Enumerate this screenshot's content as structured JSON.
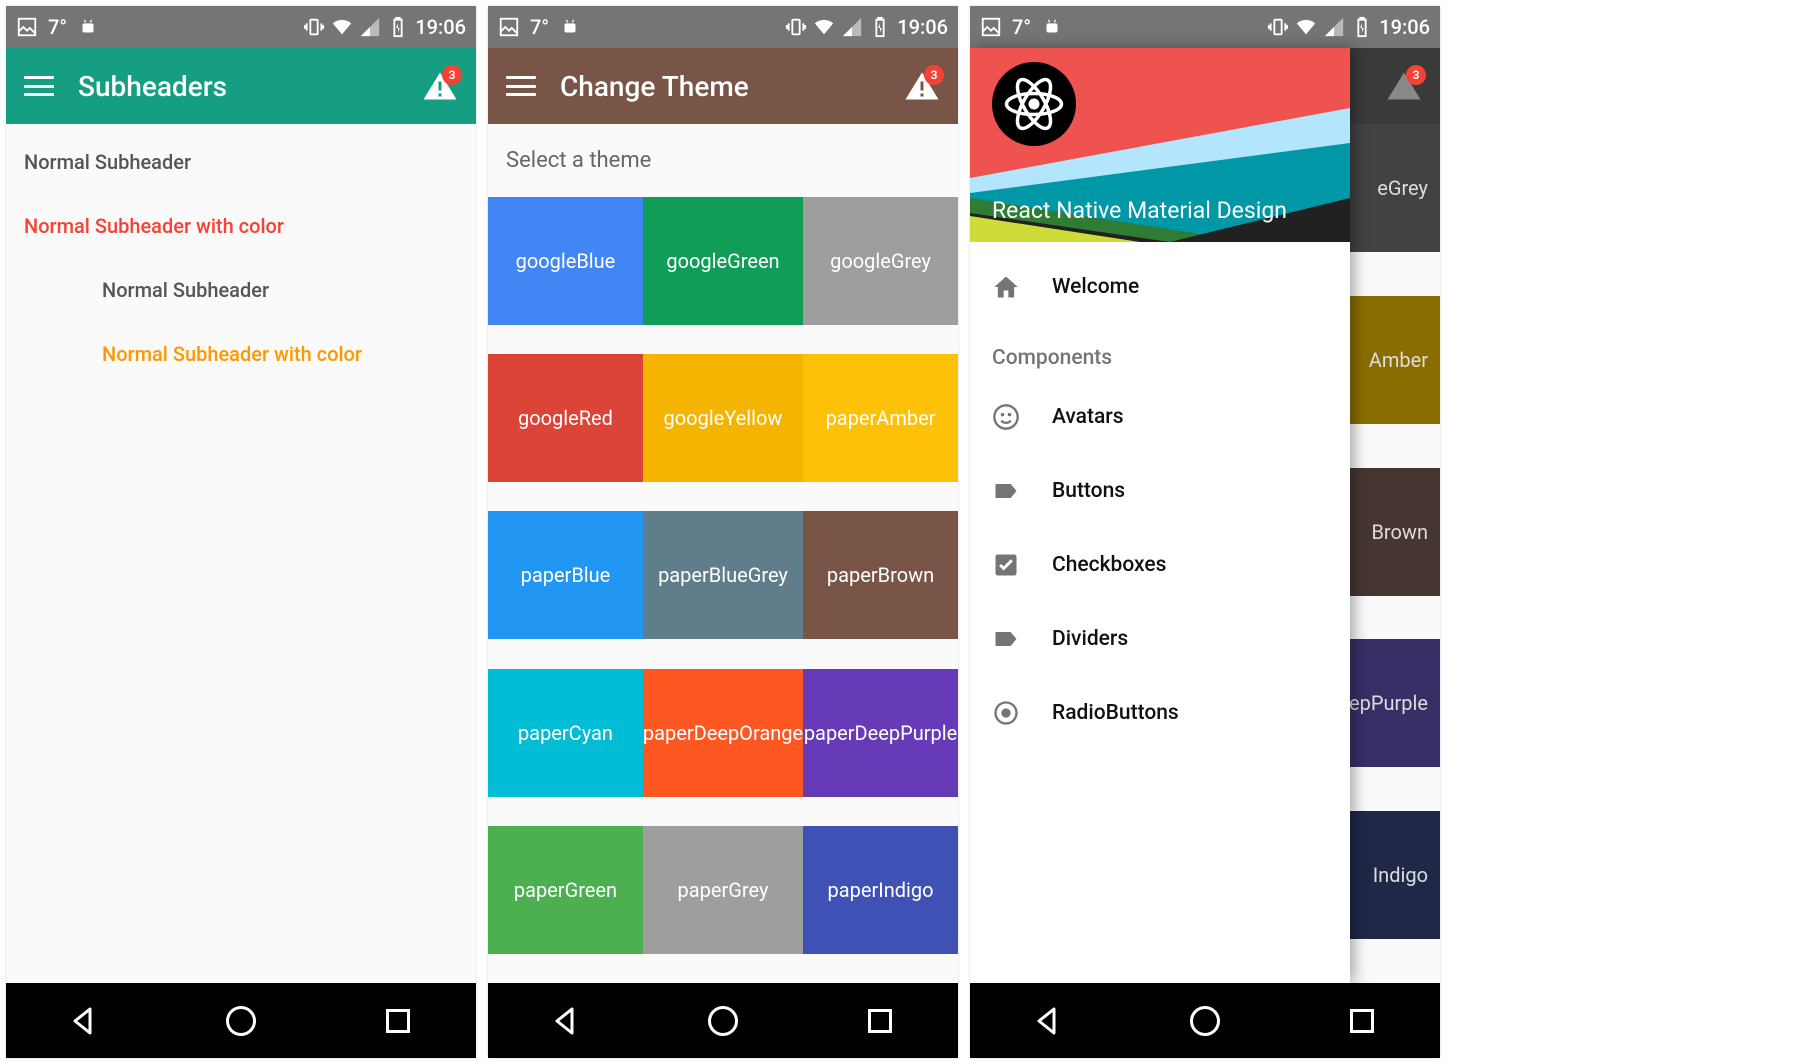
{
  "statusbar": {
    "temperature": "7°",
    "time": "19:06"
  },
  "badge_count": "3",
  "screen1": {
    "title": "Subheaders",
    "items": [
      {
        "label": "Normal Subheader",
        "color": "#555",
        "inset": false
      },
      {
        "label": "Normal Subheader with color",
        "color": "#f44336",
        "inset": false
      },
      {
        "label": "Normal Subheader",
        "color": "#555",
        "inset": true
      },
      {
        "label": "Normal Subheader with color",
        "color": "#ff9800",
        "inset": true
      }
    ]
  },
  "screen2": {
    "title": "Change Theme",
    "select_label": "Select a theme",
    "themes": [
      {
        "label": "googleBlue",
        "color": "#4285f4"
      },
      {
        "label": "googleGreen",
        "color": "#0f9d58"
      },
      {
        "label": "googleGrey",
        "color": "#9e9e9e"
      },
      {
        "label": "googleRed",
        "color": "#db4437"
      },
      {
        "label": "googleYellow",
        "color": "#f4b400"
      },
      {
        "label": "paperAmber",
        "color": "#ffc107"
      },
      {
        "label": "paperBlue",
        "color": "#2196f3"
      },
      {
        "label": "paperBlueGrey",
        "color": "#607d8b"
      },
      {
        "label": "paperBrown",
        "color": "#795548"
      },
      {
        "label": "paperCyan",
        "color": "#00bcd4"
      },
      {
        "label": "paperDeepOrange",
        "color": "#ff5722"
      },
      {
        "label": "paperDeepPurple",
        "color": "#673ab7"
      },
      {
        "label": "paperGreen",
        "color": "#4caf50"
      },
      {
        "label": "paperGrey",
        "color": "#9e9e9e"
      },
      {
        "label": "paperIndigo",
        "color": "#3f51b5"
      }
    ]
  },
  "screen3": {
    "drawer_title": "React Native Material Design",
    "welcome_label": "Welcome",
    "section_label": "Components",
    "items": [
      {
        "label": "Avatars",
        "icon": "face"
      },
      {
        "label": "Buttons",
        "icon": "label"
      },
      {
        "label": "Checkboxes",
        "icon": "checkbox"
      },
      {
        "label": "Dividers",
        "icon": "label"
      },
      {
        "label": "RadioButtons",
        "icon": "radio"
      }
    ],
    "bg_themes": [
      {
        "label": "",
        "color": "#424242"
      },
      {
        "label": "",
        "color": "#424242"
      },
      {
        "label": "eGrey",
        "color": "#424242"
      },
      {
        "label": "",
        "color": "#8a6d00"
      },
      {
        "label": "",
        "color": "#8a6d00"
      },
      {
        "label": "Amber",
        "color": "#8a6d00"
      },
      {
        "label": "",
        "color": "#453631"
      },
      {
        "label": "",
        "color": "#453631"
      },
      {
        "label": "Brown",
        "color": "#453631"
      },
      {
        "label": "",
        "color": "#3a2e66"
      },
      {
        "label": "",
        "color": "#3a2e66"
      },
      {
        "label": "epPurple",
        "color": "#3a2e66"
      },
      {
        "label": "",
        "color": "#202848"
      },
      {
        "label": "",
        "color": "#202848"
      },
      {
        "label": "Indigo",
        "color": "#202848"
      }
    ]
  }
}
